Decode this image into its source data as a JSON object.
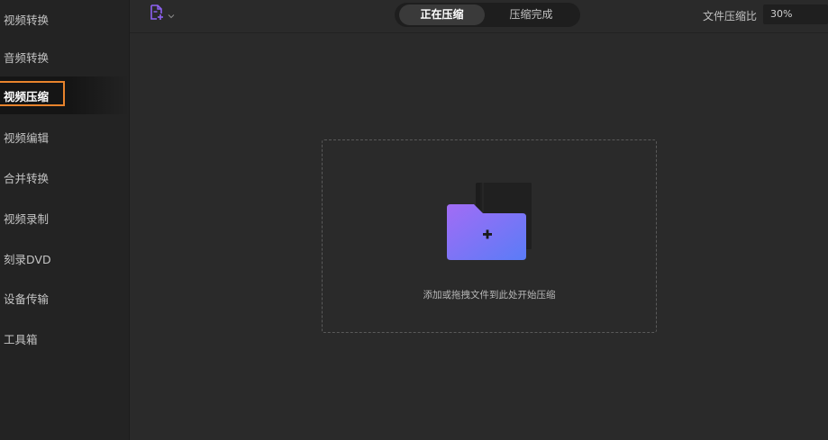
{
  "sidebar": {
    "items": [
      {
        "label": "视频转换"
      },
      {
        "label": "音频转换"
      },
      {
        "label": "视频压缩"
      },
      {
        "label": "视频编辑"
      },
      {
        "label": "合并转换"
      },
      {
        "label": "视频录制"
      },
      {
        "label": "刻录DVD"
      },
      {
        "label": "设备传输"
      },
      {
        "label": "工具箱"
      }
    ],
    "active_index": 2
  },
  "header": {
    "add_file_icon": "add-file-icon",
    "tabs": [
      {
        "label": "正在压缩",
        "active": true
      },
      {
        "label": "压缩完成",
        "active": false
      }
    ],
    "compress_ratio": {
      "label": "文件压缩比",
      "value": "30%"
    }
  },
  "dropzone": {
    "icon": "folder-plus-icon",
    "hint": "添加或拖拽文件到此处开始压缩"
  },
  "colors": {
    "background": "#2a2a2a",
    "sidebar": "#232323",
    "accent_outline": "#e8832c",
    "folder_gradient_start": "#9f6bf5",
    "folder_gradient_end": "#5a7cf7",
    "icon_purple": "#8e62f2"
  }
}
